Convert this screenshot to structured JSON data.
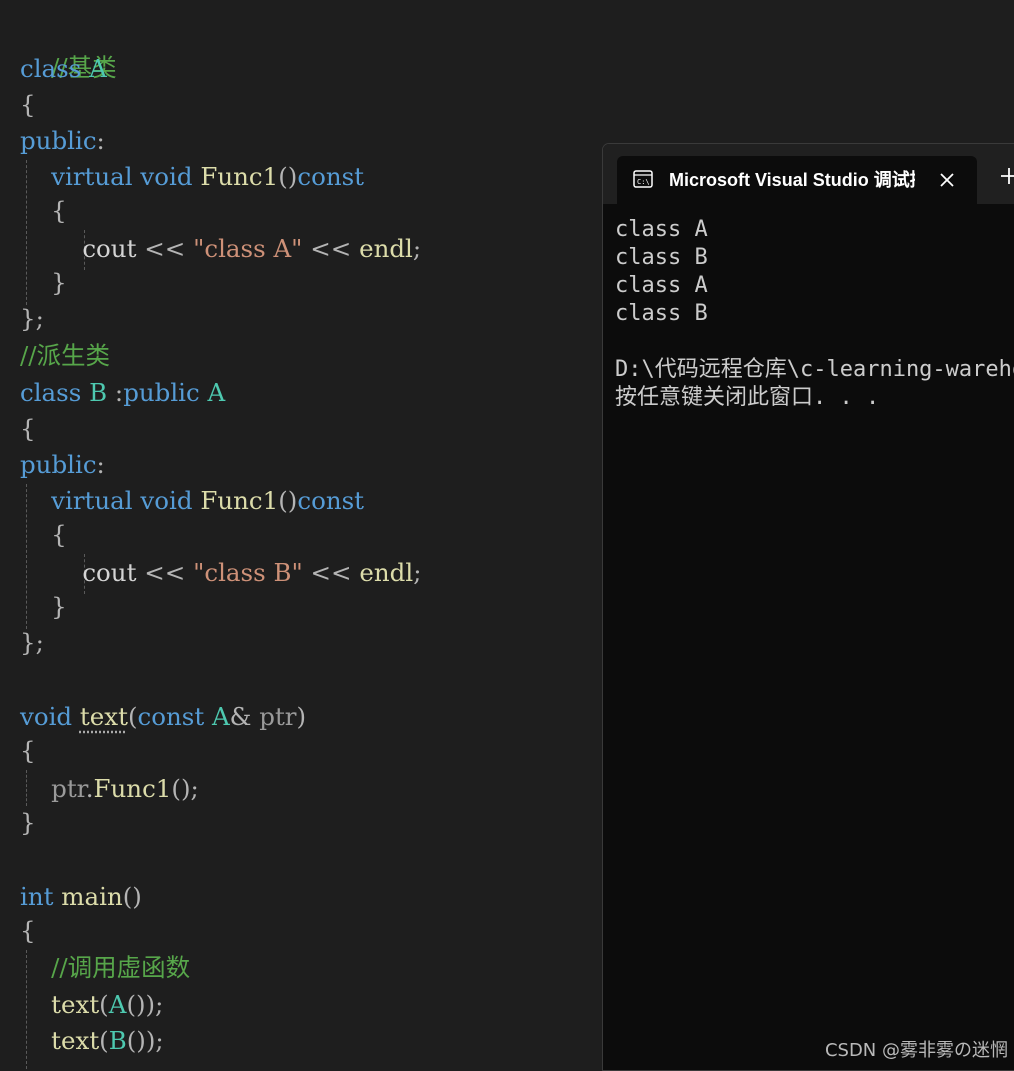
{
  "editor": {
    "lines": {
      "c1": "//基类",
      "l2_kw": "class",
      "l2_cls": "A",
      "brace_open": "{",
      "brace_close": "}",
      "brace_semi": "};",
      "public": "public",
      "colon": ":",
      "virtual": "virtual",
      "void": "void",
      "func1": "Func1",
      "parens": "()",
      "const": "const",
      "cout": "cout",
      "shl": "<<",
      "strA": "\"class A\"",
      "strB": "\"class B\"",
      "endl": "endl",
      "semi": ";",
      "c2": "//派生类",
      "class_b": "B",
      "inherit_colon": ":",
      "text": "text",
      "lparen": "(",
      "rparen": ")",
      "amp": "&",
      "ptr": "ptr",
      "dot": ".",
      "call_end": "();",
      "int": "int",
      "main": "main",
      "c3": "//调用虚函数",
      "call_a_end": "());",
      "cls_a": "A",
      "cls_b": "B"
    }
  },
  "console": {
    "tab_title": "Microsoft Visual Studio 调试控制台",
    "tab_icon": "terminal-icon",
    "close_icon": "close-icon",
    "new_tab_icon": "plus-icon",
    "output": [
      "class A",
      "class B",
      "class A",
      "class B",
      "",
      "D:\\代码远程仓库\\c-learning-warehouse",
      "按任意键关闭此窗口. . ."
    ]
  },
  "watermark": "CSDN @雾非雾の迷惘",
  "colors": {
    "editor_bg": "#1e1e1e",
    "keyword": "#569cd6",
    "type": "#4ec9b0",
    "function": "#dcdcaa",
    "string": "#ce9178",
    "comment": "#57a64a",
    "console_bg": "#0c0c0c"
  }
}
